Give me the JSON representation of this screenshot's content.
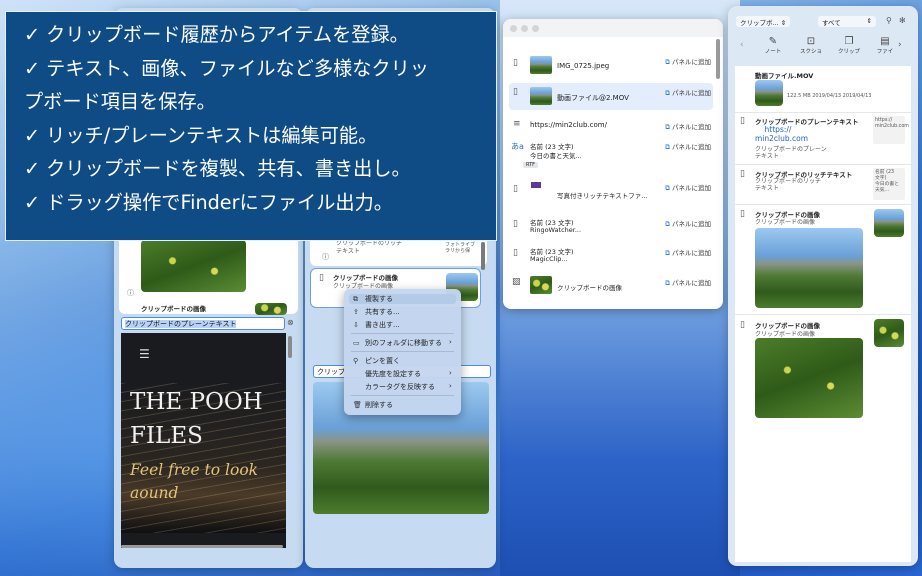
{
  "callout": {
    "lines": [
      "✓ クリップボード履歴からアイテムを登録。",
      "✓ テキスト、画像、ファイルなど多様なクリッ",
      "プボード項目を保存。",
      "✓ リッチ/プレーンテキストは編集可能。",
      "✓ クリップボードを複製、共有、書き出し。",
      "✓ ドラッグ操作でFinderにファイル出力。"
    ]
  },
  "left_panel": {
    "bottom_title": "クリップボードの画像",
    "edit_field_value": "クリップボードのプレーンテキスト",
    "pooh_title": "THE POOH\nFILES",
    "pooh_subtitle": "Feel free to look\naound"
  },
  "center_panel": {
    "rich_title": "クリップボードのリッチ",
    "rich_sub": "テキスト",
    "rich_side": "フォトライブ\nラリから保",
    "card_title": "クリップボードの画像",
    "card_sub": "クリップボードの画像",
    "field_prefix": "クリップ"
  },
  "context_menu": {
    "items": [
      {
        "icon": "⧉",
        "label": "複製する",
        "submenu": false
      },
      {
        "icon": "⇪",
        "label": "共有する...",
        "submenu": false
      },
      {
        "icon": "⇩",
        "label": "書き出す...",
        "submenu": false
      },
      {
        "icon": "▭",
        "label": "別のフォルダに移動する",
        "submenu": true
      },
      {
        "icon": "⚲",
        "label": "ピンを置く",
        "submenu": false
      },
      {
        "icon": "",
        "label": "優先度を設定する",
        "submenu": true
      },
      {
        "icon": "",
        "label": "カラータグを反映する",
        "submenu": true
      },
      {
        "icon": "🗑",
        "label": "削除する",
        "submenu": false
      }
    ]
  },
  "history_window": {
    "add_label": "パネルに追加",
    "rows": [
      {
        "icon": "doc-icon",
        "title": "IMG_0725.jpeg",
        "sub": ""
      },
      {
        "icon": "doc-icon",
        "title": "動画ファイル@2.MOV",
        "sub": ""
      },
      {
        "icon": "text-icon",
        "title": "https://min2club.com/",
        "sub": ""
      },
      {
        "icon": "aa-icon",
        "title": "名前 (23 文字)",
        "sub": "今日の書と天気...",
        "badge": "RTF"
      },
      {
        "icon": "doc-icon",
        "title": "写真付きリッチテキストファ...",
        "sub": ""
      },
      {
        "icon": "doc-icon",
        "title": "名前 (23 文字)",
        "sub": "RingoWatcher..."
      },
      {
        "icon": "doc-icon",
        "title": "名前 (23 文字)",
        "sub": "MagicClip..."
      },
      {
        "icon": "image-icon",
        "title": "クリップボードの画像",
        "sub": ""
      }
    ]
  },
  "right_panel": {
    "folder_select": "クリップボ...",
    "filter_select": "すべて",
    "tools": [
      "ノート",
      "スクショ",
      "クリップ",
      "ファイ"
    ],
    "items": [
      {
        "title": "動画ファイル.MOV",
        "meta": "122.5 MB   2019/04/13   2019/04/13"
      },
      {
        "title": "クリップボードのプレーンテキスト",
        "link": "https://\nmin2club.com",
        "sub": "クリップボードのプレーン\nテキスト",
        "side": "https://\nmin2club.com"
      },
      {
        "title": "クリップボードのリッチテキスト",
        "sub": "クリップボードのリッチ\nテキスト",
        "side": "名前 (23\n文字)\n今日の書と\n天気..."
      },
      {
        "title": "クリップボードの画像",
        "sub": "クリップボードの画像"
      },
      {
        "title": "クリップボードの画像",
        "sub": "クリップボードの画像"
      }
    ]
  }
}
